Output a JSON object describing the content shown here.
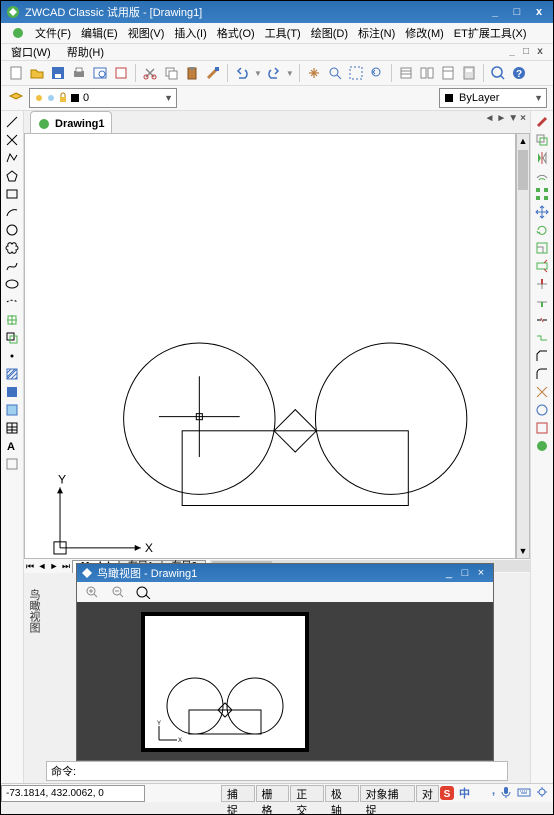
{
  "title": "ZWCAD Classic 试用版 - [Drawing1]",
  "menus": [
    "文件(F)",
    "编辑(E)",
    "视图(V)",
    "插入(I)",
    "格式(O)",
    "工具(T)",
    "绘图(D)",
    "标注(N)",
    "修改(M)",
    "ET扩展工具(X)"
  ],
  "menus2": [
    "窗口(W)",
    "帮助(H)"
  ],
  "layer_value": "0",
  "bylayer": "ByLayer",
  "doc_tab": "Drawing1",
  "tabs": {
    "model": "Model",
    "layout1": "布局1",
    "layout2": "布局2"
  },
  "aerial": {
    "title": "鸟瞰视图 - Drawing1"
  },
  "side_label": "鸟瞰视图",
  "cmd_prompt": "命令:",
  "coords": "-73.1814, 432.0062, 0",
  "status_buttons": [
    "捕捉",
    "栅格",
    "正交",
    "极轴",
    "对象捕捉",
    "对"
  ],
  "tray_text": "中"
}
